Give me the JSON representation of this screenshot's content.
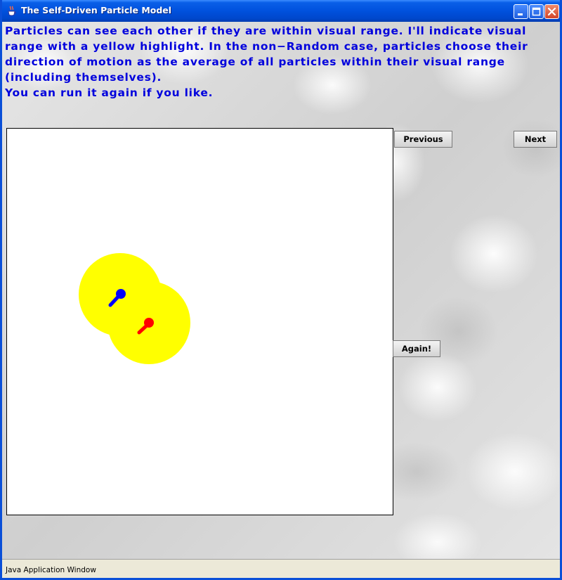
{
  "window": {
    "title": "The Self-Driven Particle Model",
    "icon": "java-cup-icon",
    "controls": [
      "minimize-icon",
      "maximize-icon",
      "close-icon"
    ]
  },
  "instructions": {
    "lines": [
      "Particles can see each other if they are within visual range.  I'll indicate visual",
      "range with a yellow highlight.  In the non−Random case, particles choose their",
      "direction of motion as the average of all particles within their visual range",
      "(including themselves).",
      "You can run it again if you like."
    ],
    "color": "#0000dd"
  },
  "simulation": {
    "background": "#ffffff",
    "range_color": "#ffff00",
    "particles": [
      {
        "name": "blue-particle",
        "color": "#0000ff"
      },
      {
        "name": "red-particle",
        "color": "#ff0000"
      }
    ]
  },
  "buttons": {
    "previous": "Previous",
    "next": "Next",
    "again": "Again!"
  },
  "status_bar": {
    "text": "Java Application Window"
  }
}
